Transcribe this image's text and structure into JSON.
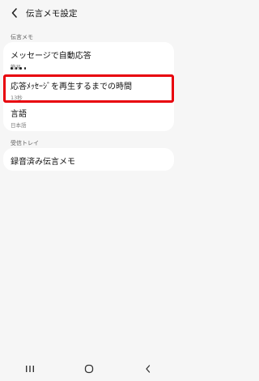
{
  "app_bar": {
    "title": "伝言メモ設定",
    "back_icon": "chevron-left-icon"
  },
  "sections": {
    "message": {
      "label": "伝言メモ",
      "items": [
        {
          "title": "メッセージで自動応答",
          "value": "簡易"
        },
        {
          "title": "応答ﾒｯｾｰｼﾞを再生するまでの時間",
          "value": "13秒"
        },
        {
          "title": "言語",
          "value": "日本語"
        }
      ]
    },
    "inbox": {
      "label": "受信トレイ",
      "items": [
        {
          "title": "録音済み伝言メモ"
        }
      ]
    }
  },
  "highlight_color": "#e8000b",
  "nav": {
    "recent": "recent-apps-icon",
    "home": "home-icon",
    "back": "back-icon"
  }
}
